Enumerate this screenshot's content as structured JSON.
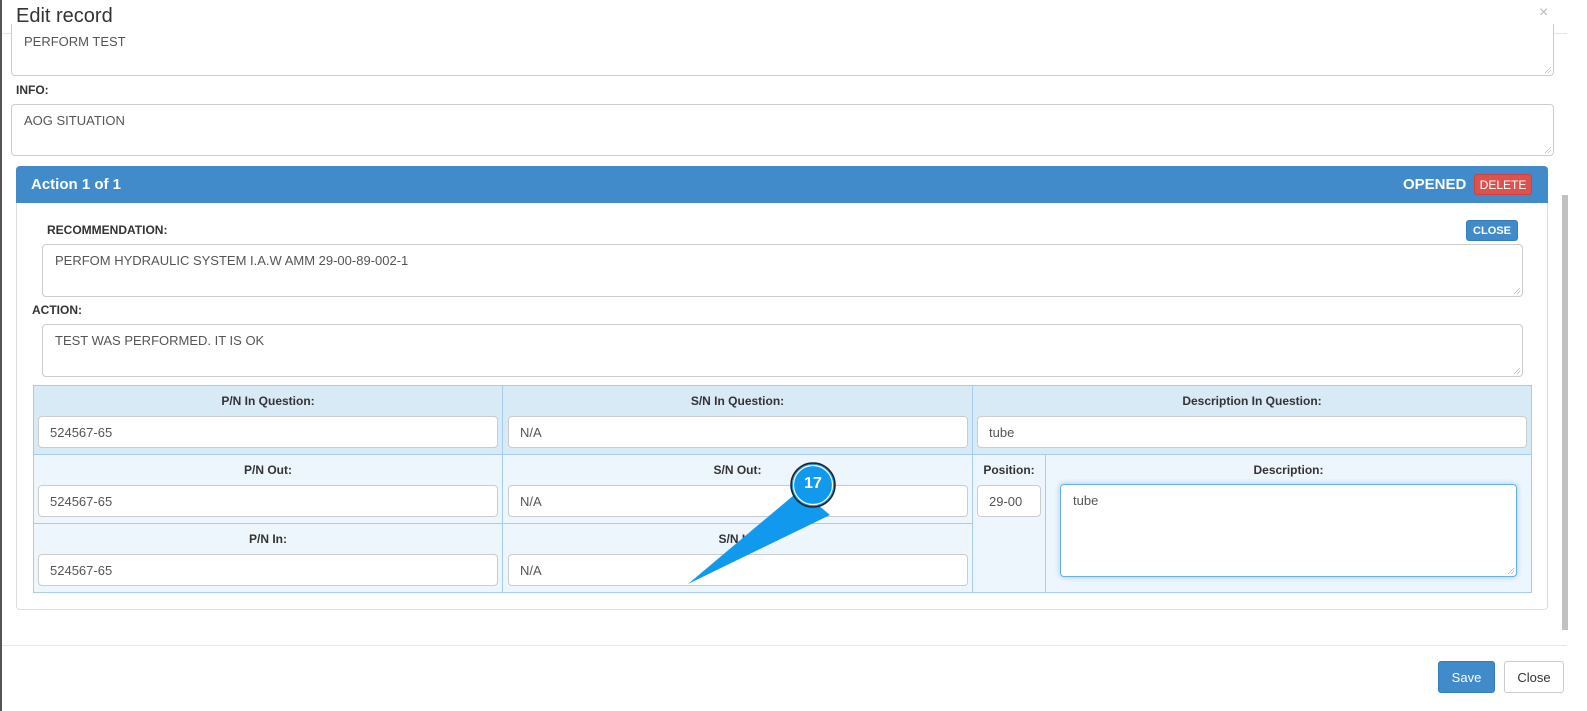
{
  "dialog": {
    "title": "Edit record",
    "close_icon": "×"
  },
  "fields": {
    "task_text": "PERFORM TEST",
    "info_label": "INFO:",
    "info_text": "AOG SITUATION"
  },
  "action": {
    "heading": "Action 1 of 1",
    "status": "OPENED",
    "delete_label": "DELETE",
    "close_label": "CLOSE",
    "recommendation_label": "RECOMMENDATION:",
    "recommendation_text": "PERFOM HYDRAULIC SYSTEM I.A.W AMM 29-00-89-002-1",
    "action_label": "ACTION:",
    "action_text": "TEST WAS PERFORMED. IT IS OK"
  },
  "parts": {
    "pn_question_label": "P/N In Question:",
    "pn_question": "524567-65",
    "sn_question_label": "S/N In Question:",
    "sn_question": "N/A",
    "desc_question_label": "Description In Question:",
    "desc_question": "tube",
    "pn_out_label": "P/N Out:",
    "pn_out": "524567-65",
    "sn_out_label": "S/N Out:",
    "sn_out": "N/A",
    "position_label": "Position:",
    "position": "29-00",
    "description_label": "Description:",
    "description": "tube",
    "pn_in_label": "P/N In:",
    "pn_in": "524567-65",
    "sn_in_label": "S/N In:",
    "sn_in": "N/A"
  },
  "callout": {
    "number": "17",
    "color": "#1199ee"
  },
  "footer": {
    "save_label": "Save",
    "close_label": "Close"
  }
}
